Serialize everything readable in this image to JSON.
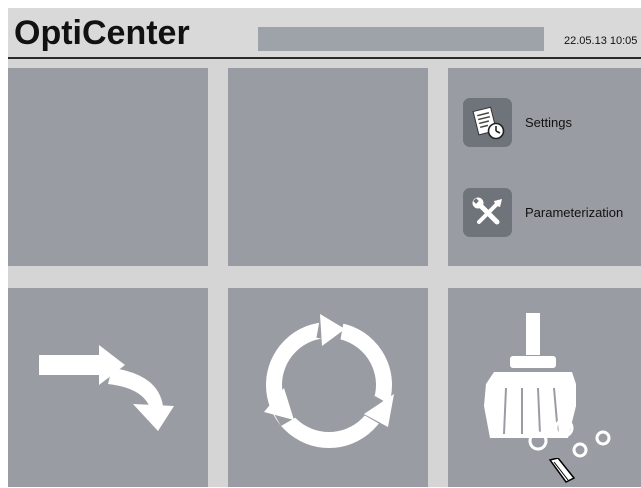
{
  "header": {
    "title": "OptiCenter",
    "datetime": "22.05.13 10:05"
  },
  "menu": {
    "settings_label": "Settings",
    "settings_icon": "settings-document-clock-icon",
    "parameterization_label": "Parameterization",
    "parameterization_icon": "wrench-screwdriver-icon"
  },
  "tiles": [
    {
      "name": "empty-tile-1"
    },
    {
      "name": "empty-tile-2"
    },
    {
      "name": "menu-tile"
    },
    {
      "name": "redirect-tile",
      "icon": "curved-arrow-icon"
    },
    {
      "name": "cycle-tile",
      "icon": "circular-arrows-icon"
    },
    {
      "name": "cleaning-tile",
      "icon": "broom-icon"
    }
  ],
  "colors": {
    "header_bg": "#d9d9d9",
    "tile_bg": "#999da3",
    "grid_bg": "#d5d5d5",
    "icon_bg": "#6f737a"
  }
}
